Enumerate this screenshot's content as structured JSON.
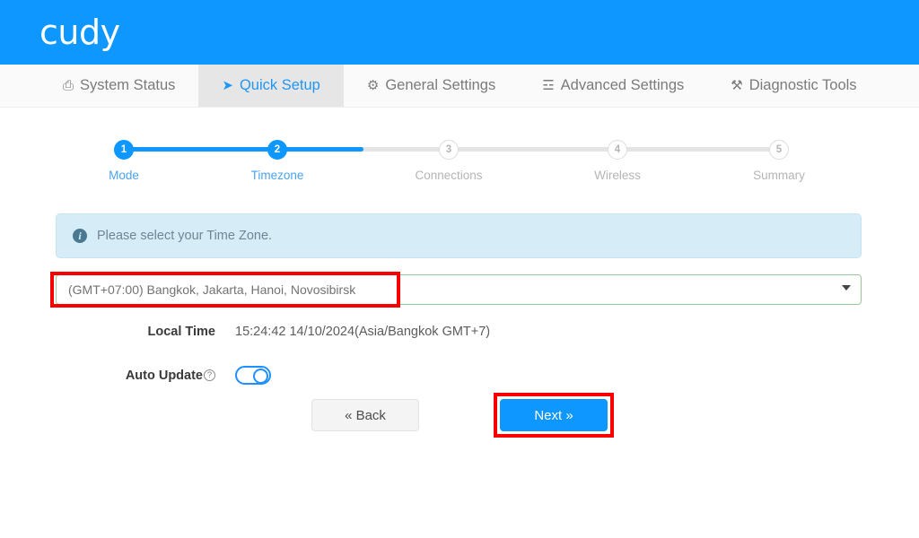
{
  "header": {
    "brand": "cudy"
  },
  "tabs": [
    {
      "label": "System Status",
      "icon": "monitor-icon",
      "glyph": "⎙",
      "active": false
    },
    {
      "label": "Quick Setup",
      "icon": "rocket-icon",
      "glyph": "➤",
      "active": true
    },
    {
      "label": "General Settings",
      "icon": "gear-icon",
      "glyph": "⚙",
      "active": false
    },
    {
      "label": "Advanced Settings",
      "icon": "sliders-icon",
      "glyph": "☲",
      "active": false
    },
    {
      "label": "Diagnostic Tools",
      "icon": "tools-icon",
      "glyph": "⚒",
      "active": false
    }
  ],
  "stepper": {
    "current_step": 2,
    "steps": [
      {
        "number": "1",
        "label": "Mode",
        "state": "done"
      },
      {
        "number": "2",
        "label": "Timezone",
        "state": "done"
      },
      {
        "number": "3",
        "label": "Connections",
        "state": "todo"
      },
      {
        "number": "4",
        "label": "Wireless",
        "state": "todo"
      },
      {
        "number": "5",
        "label": "Summary",
        "state": "todo"
      }
    ]
  },
  "alert": {
    "icon": "info-icon",
    "glyph": "i",
    "text": "Please select your Time Zone."
  },
  "timezone": {
    "selected": "(GMT+07:00) Bangkok, Jakarta, Hanoi, Novosibirsk",
    "options": [
      "(GMT+07:00) Bangkok, Jakarta, Hanoi, Novosibirsk"
    ]
  },
  "local_time": {
    "label": "Local Time",
    "value": "15:24:42 14/10/2024(Asia/Bangkok GMT+7)"
  },
  "auto_update": {
    "label": "Auto Update",
    "help_glyph": "?",
    "enabled": true
  },
  "buttons": {
    "back": "« Back",
    "next": "Next »"
  },
  "colors": {
    "brand_blue": "#0d97ff",
    "active_tab_bg": "#e6e6e6",
    "alert_bg": "#d6ecf6",
    "select_border_green": "#9ac79a",
    "highlight_red": "#f90000"
  }
}
